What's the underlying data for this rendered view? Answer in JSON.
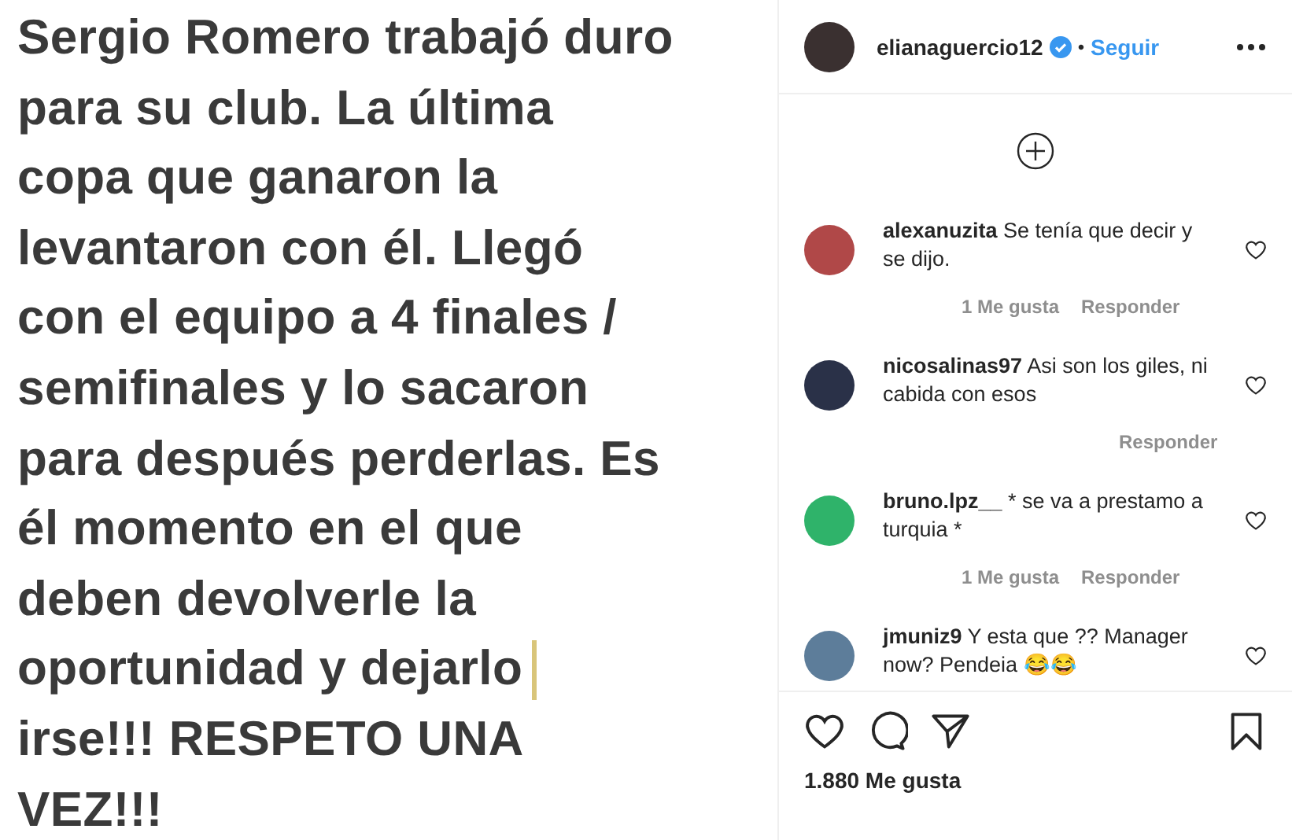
{
  "post_image": {
    "lines": [
      {
        "text": "Sergio Romero trabajó duro",
        "cursor": false
      },
      {
        "text": "para su club. La última",
        "cursor": false
      },
      {
        "text": "copa que ganaron la",
        "cursor": false
      },
      {
        "text": "levantaron con él. Llegó",
        "cursor": false
      },
      {
        "text": "con el equipo a 4 finales /",
        "cursor": false
      },
      {
        "text": "semifinales y lo sacaron",
        "cursor": false
      },
      {
        "text": "para después perderlas. Es",
        "cursor": false
      },
      {
        "text": "él momento en el que",
        "cursor": false
      },
      {
        "text": "deben devolverle la",
        "cursor": false
      },
      {
        "text": "oportunidad y dejarlo",
        "cursor": true
      },
      {
        "text": "irse!!! RESPETO UNA",
        "cursor": false
      },
      {
        "text": "VEZ!!!",
        "cursor": false
      }
    ]
  },
  "header": {
    "username": "elianaguercio12",
    "verified": true,
    "separator": "•",
    "follow": "Seguir"
  },
  "comments": [
    {
      "username": "alexanuzita",
      "text": "Se tenía que decir y se dijo.",
      "likes": "1 Me gusta",
      "reply": "Responder"
    },
    {
      "username": "nicosalinas97",
      "text": "Asi son los giles, ni cabida con esos",
      "reply": "Responder"
    },
    {
      "username": "bruno.lpz__",
      "text": "* se va a prestamo a turquia *",
      "likes": "1 Me gusta",
      "reply": "Responder"
    },
    {
      "username": "jmuniz9",
      "text": "Y esta que ?? Manager now? Pendeia 😂😂"
    }
  ],
  "likes_count": "1.880 Me gusta"
}
